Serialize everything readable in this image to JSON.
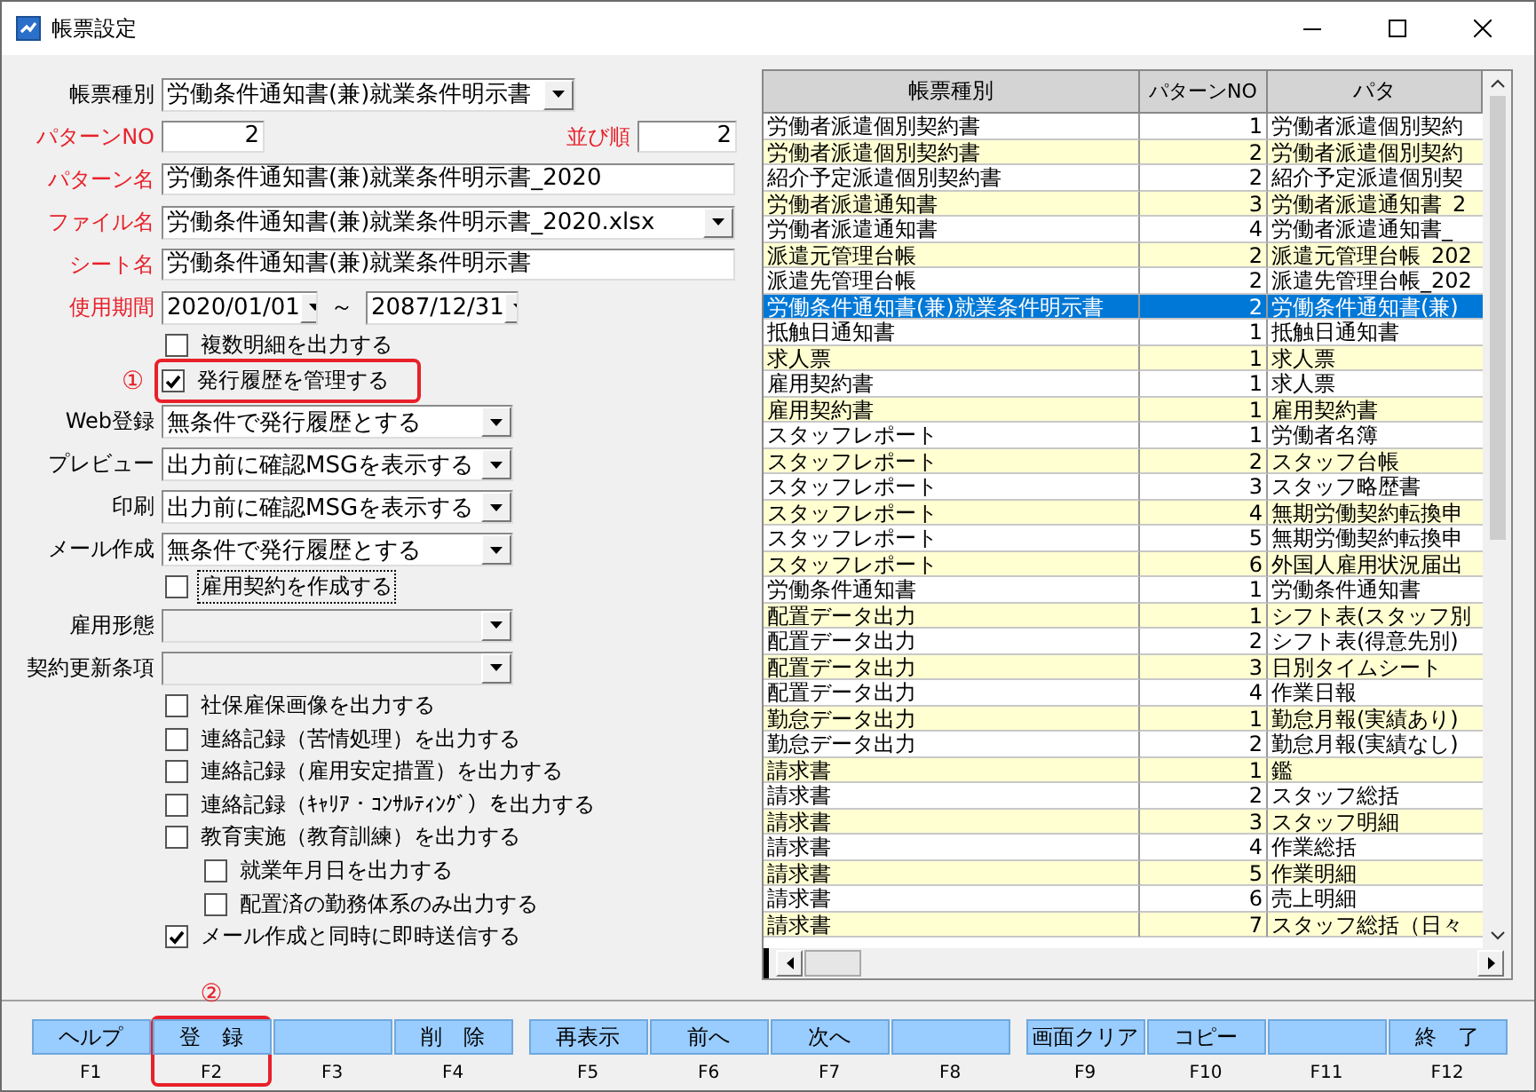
{
  "window": {
    "title": "帳票設定"
  },
  "form": {
    "items": [
      {
        "kind": "typecombo",
        "label": "帳票種別",
        "required": false,
        "disabled": false,
        "value": "労働条件通知書(兼)就業条件明示書"
      },
      {
        "kind": "pair",
        "label": "パターンNO",
        "required": true,
        "value": "2",
        "label2": "並び順",
        "value2": "2"
      },
      {
        "kind": "text",
        "label": "パターン名",
        "required": true,
        "value": "労働条件通知書(兼)就業条件明示書_2020"
      },
      {
        "kind": "filecombo",
        "label": "ファイル名",
        "required": true,
        "disabled": false,
        "value": "労働条件通知書(兼)就業条件明示書_2020.xlsx"
      },
      {
        "kind": "text",
        "label": "シート名",
        "required": true,
        "value": "労働条件通知書(兼)就業条件明示書"
      },
      {
        "kind": "range",
        "label": "使用期間",
        "required": true,
        "from": "2020/01/01",
        "separator": "～",
        "to": "2087/12/31"
      },
      {
        "kind": "checkbox",
        "label": "複数明細を出力する",
        "checked": false,
        "focused": false
      },
      {
        "kind": "checkbox",
        "label": "発行履歴を管理する",
        "checked": true,
        "focused": false,
        "callout": "①"
      },
      {
        "kind": "combo",
        "label": "Web登録",
        "required": false,
        "disabled": false,
        "value": "無条件で発行履歴とする"
      },
      {
        "kind": "combo",
        "label": "プレビュー",
        "required": false,
        "disabled": false,
        "value": "出力前に確認MSGを表示する"
      },
      {
        "kind": "combo",
        "label": "印刷",
        "required": false,
        "disabled": false,
        "value": "出力前に確認MSGを表示する"
      },
      {
        "kind": "combo",
        "label": "メール作成",
        "required": false,
        "disabled": false,
        "value": "無条件で発行履歴とする"
      },
      {
        "kind": "checkbox",
        "label": "雇用契約を作成する",
        "checked": false,
        "focused": true
      },
      {
        "kind": "combo",
        "label": "雇用形態",
        "required": false,
        "disabled": true
      },
      {
        "kind": "combo",
        "label": "契約更新条項",
        "required": false,
        "disabled": true
      },
      {
        "kind": "checkbox",
        "label": "社保雇保画像を出力する",
        "checked": false,
        "focused": false
      },
      {
        "kind": "checkbox",
        "label": "連絡記録（苦情処理）を出力する",
        "checked": false,
        "focused": false
      },
      {
        "kind": "checkbox",
        "label": "連絡記録（雇用安定措置）を出力する",
        "checked": false,
        "focused": false
      },
      {
        "kind": "checkbox",
        "label": "連絡記録（ｷｬﾘｱ・ｺﾝｻﾙﾃｨﾝｸﾞ）を出力する",
        "checked": false,
        "focused": false
      },
      {
        "kind": "checkbox",
        "label": "教育実施（教育訓練）を出力する",
        "checked": false,
        "focused": false,
        "children": [
          {
            "kind": "checkbox",
            "label": "就業年月日を出力する",
            "checked": false,
            "focused": false
          },
          {
            "kind": "checkbox",
            "label": "配置済の勤務体系のみ出力する",
            "checked": false,
            "focused": false
          }
        ]
      },
      {
        "kind": "checkbox",
        "label": "メール作成と同時に即時送信する",
        "checked": true,
        "focused": false
      }
    ]
  },
  "table": {
    "columns": [
      "帳票種別",
      "パターンNO",
      "パタ"
    ],
    "rows": [
      {
        "cells": [
          "労働者派遣個別契約書",
          "1",
          "労働者派遣個別契約"
        ],
        "selected": false
      },
      {
        "cells": [
          "労働者派遣個別契約書",
          "2",
          "労働者派遣個別契約"
        ],
        "selected": false
      },
      {
        "cells": [
          "紹介予定派遣個別契約書",
          "2",
          "紹介予定派遣個別契"
        ],
        "selected": false
      },
      {
        "cells": [
          "労働者派遣通知書",
          "3",
          "労働者派遣通知書_2"
        ],
        "selected": false
      },
      {
        "cells": [
          "労働者派遣通知書",
          "4",
          "労働者派遣通知書_"
        ],
        "selected": false
      },
      {
        "cells": [
          "派遣元管理台帳",
          "2",
          "派遣元管理台帳_202"
        ],
        "selected": false
      },
      {
        "cells": [
          "派遣先管理台帳",
          "2",
          "派遣先管理台帳_202"
        ],
        "selected": false
      },
      {
        "cells": [
          "労働条件通知書(兼)就業条件明示書",
          "2",
          "労働条件通知書(兼)"
        ],
        "selected": true
      },
      {
        "cells": [
          "抵触日通知書",
          "1",
          "抵触日通知書"
        ],
        "selected": false
      },
      {
        "cells": [
          "求人票",
          "1",
          "求人票"
        ],
        "selected": false
      },
      {
        "cells": [
          "雇用契約書",
          "1",
          "求人票"
        ],
        "selected": false
      },
      {
        "cells": [
          "雇用契約書",
          "1",
          "雇用契約書"
        ],
        "selected": false
      },
      {
        "cells": [
          "スタッフレポート",
          "1",
          "労働者名簿"
        ],
        "selected": false
      },
      {
        "cells": [
          "スタッフレポート",
          "2",
          "スタッフ台帳"
        ],
        "selected": false
      },
      {
        "cells": [
          "スタッフレポート",
          "3",
          "スタッフ略歴書"
        ],
        "selected": false
      },
      {
        "cells": [
          "スタッフレポート",
          "4",
          "無期労働契約転換申"
        ],
        "selected": false
      },
      {
        "cells": [
          "スタッフレポート",
          "5",
          "無期労働契約転換申"
        ],
        "selected": false
      },
      {
        "cells": [
          "スタッフレポート",
          "6",
          "外国人雇用状況届出"
        ],
        "selected": false
      },
      {
        "cells": [
          "労働条件通知書",
          "1",
          "労働条件通知書"
        ],
        "selected": false
      },
      {
        "cells": [
          "配置データ出力",
          "1",
          "シフト表(スタッフ別"
        ],
        "selected": false
      },
      {
        "cells": [
          "配置データ出力",
          "2",
          "シフト表(得意先別)"
        ],
        "selected": false
      },
      {
        "cells": [
          "配置データ出力",
          "3",
          "日別タイムシート"
        ],
        "selected": false
      },
      {
        "cells": [
          "配置データ出力",
          "4",
          "作業日報"
        ],
        "selected": false
      },
      {
        "cells": [
          "勤怠データ出力",
          "1",
          "勤怠月報(実績あり)"
        ],
        "selected": false
      },
      {
        "cells": [
          "勤怠データ出力",
          "2",
          "勤怠月報(実績なし)"
        ],
        "selected": false
      },
      {
        "cells": [
          "請求書",
          "1",
          "鑑"
        ],
        "selected": false
      },
      {
        "cells": [
          "請求書",
          "2",
          "スタッフ総括"
        ],
        "selected": false
      },
      {
        "cells": [
          "請求書",
          "3",
          "スタッフ明細"
        ],
        "selected": false
      },
      {
        "cells": [
          "請求書",
          "4",
          "作業総括"
        ],
        "selected": false
      },
      {
        "cells": [
          "請求書",
          "5",
          "作業明細"
        ],
        "selected": false
      },
      {
        "cells": [
          "請求書",
          "6",
          "売上明細"
        ],
        "selected": false
      },
      {
        "cells": [
          "請求書",
          "7",
          "スタッフ総括（日々"
        ],
        "selected": false
      }
    ]
  },
  "function_keys": {
    "groups": [
      [
        {
          "label": "ヘルプ",
          "key": "F1"
        },
        {
          "label": "登　録",
          "key": "F2",
          "callout": "②"
        },
        {
          "key": "F3"
        },
        {
          "label": "削　除",
          "key": "F4"
        }
      ],
      [
        {
          "label": "再表示",
          "key": "F5"
        },
        {
          "label": "前へ",
          "key": "F6"
        },
        {
          "label": "次へ",
          "key": "F7"
        },
        {
          "key": "F8"
        }
      ],
      [
        {
          "label": "画面クリア",
          "key": "F9"
        },
        {
          "label": "コピー",
          "key": "F10"
        },
        {
          "key": "F11"
        },
        {
          "label": "終　了",
          "key": "F12"
        }
      ]
    ]
  }
}
